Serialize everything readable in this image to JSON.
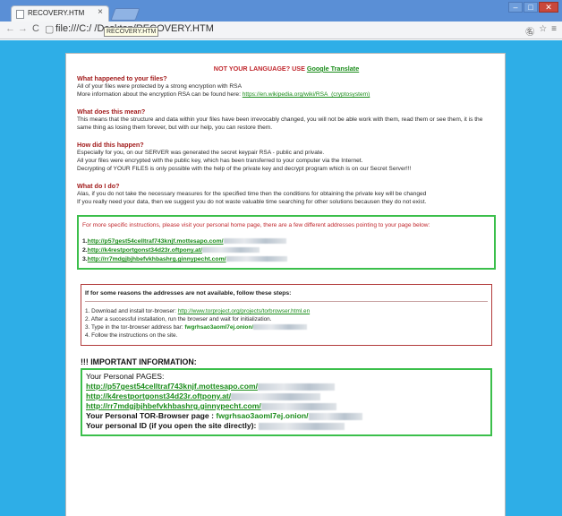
{
  "browser": {
    "tab_title": "RECOVERY.HTM",
    "tab_close": "×",
    "url": "file:///C:/            /Desktop/RECOVERY.HTM",
    "tooltip": "RECOVERY.HTM",
    "back_icon": "←",
    "forward_icon": "→",
    "reload_icon": "C",
    "page_icon": "▢",
    "translate_icon": "㊔",
    "star_icon": "☆",
    "menu_icon": "≡",
    "min_label": "‒",
    "max_label": "□",
    "close_label": "✕"
  },
  "doc": {
    "lang_prefix": "NOT YOUR LANGUAGE? USE ",
    "lang_link": "Google Translate",
    "s1_title": "What happened to your files?",
    "s1_l1": "All of your files were protected by a strong encryption with RSA",
    "s1_l2_prefix": "More information about the encryption RSA can be found here: ",
    "s1_l2_link": "https://en.wikipedia.org/wiki/RSA_(cryptosystem)",
    "s2_title": "What does this mean?",
    "s2_l1": "This means that the structure and data within your files have been irrevocably changed, you will not be able work with them, read them or see them, it is the same thing as losing them forever, but with our help, you can restore them.",
    "s3_title": "How did this happen?",
    "s3_l1": "Especially for you, on our SERVER was generated the secret keypair RSA - public and private.",
    "s3_l2": "All your files were encrypted with the public key, which has been transferred to your computer via the Internet.",
    "s3_l3": "Decrypting of YOUR FILES is only possible with the help of the private key and decrypt program which is on our Secret Server!!!",
    "s4_title": "What do I do?",
    "s4_l1": "Alas, if you do not take the necessary measures for the specified time then the conditions for obtaining the private key will be changed",
    "s4_l2": "If you really need your data, then we suggest you do not waste valuable time searching for other solutions becausen they do not exist.",
    "instr_intro": "For more specific instructions, please visit your personal home page, there are a few different addresses pointing to your page below:",
    "addresses": [
      {
        "num": "1.",
        "url": "http://p57gest54celltraf743knjf.mottesapo.com/"
      },
      {
        "num": "2.",
        "url": "http://k4restportgonst34d23r.oftpony.at/"
      },
      {
        "num": "3.",
        "url": "http://rr7mdgjbjhbefvkhbashrg.ginnypecht.com/"
      }
    ],
    "alt_header": "If for some reasons the addresses are not available, follow these steps:",
    "step1_prefix": "1. Download and install tor-browser: ",
    "step1_link": "http://www.torproject.org/projects/torbrowser.html.en",
    "step2": "2. After a successful installation, run the browser and wait for initialization.",
    "step3_prefix": "3. Type in the tor-browser address bar: ",
    "step3_onion": "fwgrhsao3aoml7ej.onion/",
    "step4": "4. Follow the instructions on the site.",
    "important_title": "!!! IMPORTANT INFORMATION:",
    "personal_pages_label": "Your Personal PAGES:",
    "big_links": [
      "http://p57gest54celltraf743knjf.mottesapo.com/",
      "http://k4restportgonst34d23r.oftpony.at/",
      "http://rr7mdgjbjhbefvkhbashrg.ginnypecht.com/"
    ],
    "tor_page_label": "Your Personal TOR-Browser page : ",
    "tor_page_onion": "fwgrhsao3aoml7ej.onion/",
    "personal_id_label": "Your personal ID (if you open the site directly): "
  },
  "colors": {
    "background": "#2eaee7",
    "heading_red": "#a21c1c",
    "link_green": "#1a8c1a",
    "box_green": "#3bbf4b"
  }
}
